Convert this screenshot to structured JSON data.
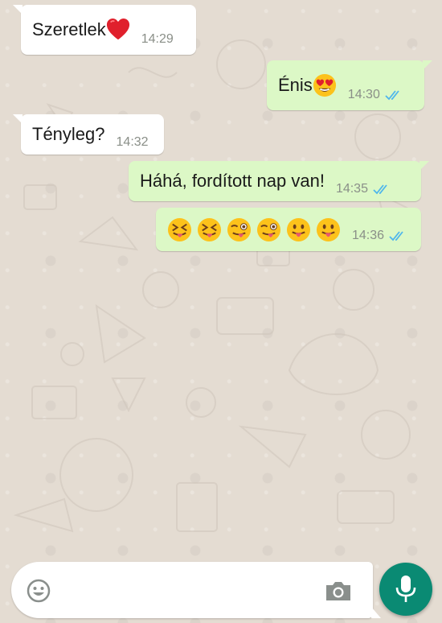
{
  "messages": [
    {
      "direction": "in",
      "text": "Szeretlek",
      "emoji": [
        "red-heart"
      ],
      "time": "14:29"
    },
    {
      "direction": "out",
      "text": "Énis",
      "emoji": [
        "heart-eyes"
      ],
      "time": "14:30",
      "status": "read"
    },
    {
      "direction": "in",
      "text": "Tényleg?",
      "emoji": [],
      "time": "14:32"
    },
    {
      "direction": "out",
      "text": "Háhá, fordított nap van!",
      "emoji": [],
      "time": "14:35",
      "status": "read"
    },
    {
      "direction": "out",
      "text": "",
      "emoji": [
        "squint-tongue",
        "squint-tongue",
        "wink-tongue",
        "wink-tongue",
        "tongue-out",
        "tongue-out"
      ],
      "time": "14:36",
      "status": "read"
    }
  ],
  "composer": {
    "placeholder": "",
    "value": ""
  },
  "icons": {
    "emoji_button": "smiley-icon",
    "camera": "camera-icon",
    "send": "mic-icon",
    "read_receipt": "double-check-icon"
  },
  "colors": {
    "incoming_bubble": "#ffffff",
    "outgoing_bubble": "#dcf8c6",
    "read_ticks": "#4fb6ec",
    "accent": "#0a8a73",
    "wallpaper": "#e4dcd2"
  }
}
